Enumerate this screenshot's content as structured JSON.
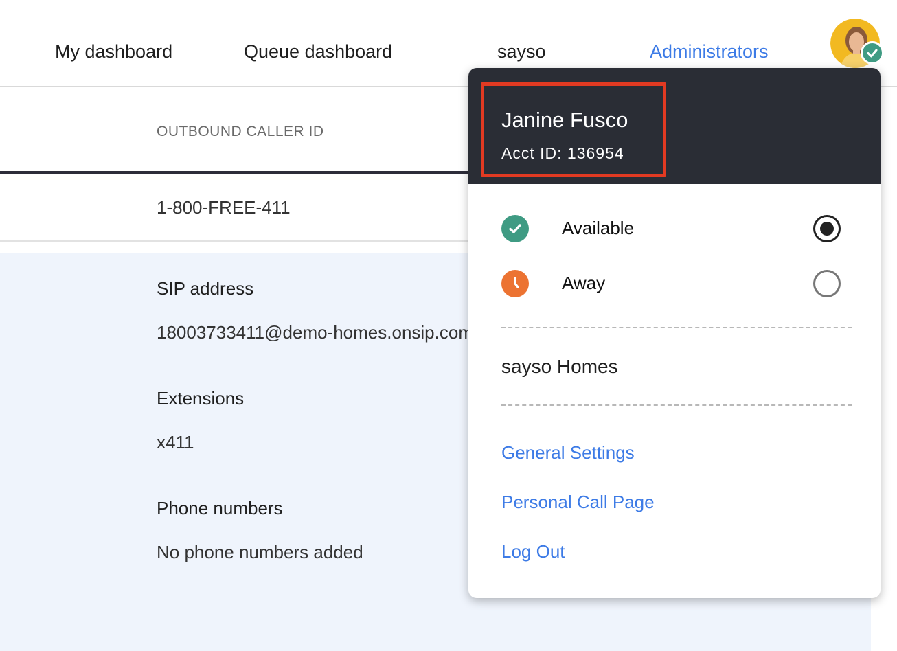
{
  "nav": {
    "items": [
      {
        "label": "My dashboard"
      },
      {
        "label": "Queue dashboard"
      },
      {
        "label": "sayso"
      },
      {
        "label": "Administrators"
      }
    ]
  },
  "table": {
    "column_header": "OUTBOUND CALLER ID",
    "row_value": "1-800-FREE-411"
  },
  "details": {
    "sip_label": "SIP address",
    "sip_value": "18003733411@demo-homes.onsip.com",
    "extensions_label": "Extensions",
    "extensions_value": "x411",
    "phone_label": "Phone numbers",
    "phone_value": "No phone numbers added"
  },
  "dropdown": {
    "user_name": "Janine Fusco",
    "acct_id": "Acct ID: 136954",
    "statuses": [
      {
        "label": "Available",
        "icon": "check-circle-icon",
        "selected": true
      },
      {
        "label": "Away",
        "icon": "clock-icon",
        "selected": false
      }
    ],
    "org_name": "sayso Homes",
    "links": [
      {
        "label": "General Settings"
      },
      {
        "label": "Personal Call Page"
      },
      {
        "label": "Log Out"
      }
    ]
  },
  "colors": {
    "accent": "#3d7be6",
    "available": "#3f9b83",
    "away": "#ec7332",
    "header_dark": "#2a2d35",
    "highlight": "#e23a22"
  }
}
